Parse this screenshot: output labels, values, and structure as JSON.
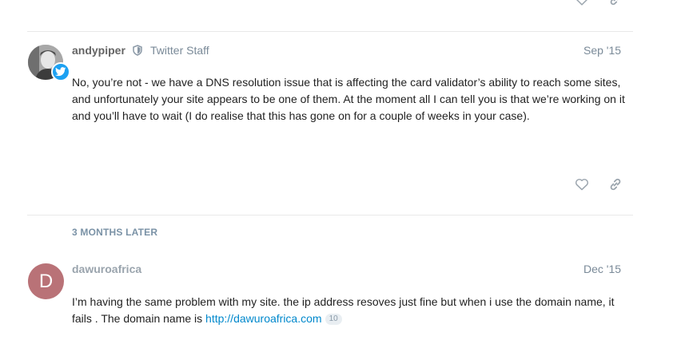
{
  "posts": [
    {
      "username": "andypiper",
      "user_title": "Twitter Staff",
      "date": "Sep '15",
      "text": "No, you’re not - we have a DNS resolution issue that is affecting the card validator’s ability to reach some sites, and unfortunately your site appears to be one of them. At the moment all I can tell you is that we’re working on it and you’ll have to wait (I do realise that this has gone on for a couple of weeks in your case)."
    },
    {
      "username": "dawuroafrica",
      "avatar_letter": "D",
      "date": "Dec '15",
      "text_before_link": "I’m having the same problem with my site. the ip address resoves just fine but when i use the domain name, it fails . The domain name is ",
      "link_text": "http://dawuroafrica.com",
      "link_clicks": "10"
    }
  ],
  "time_gap": "3 MONTHS LATER",
  "icons": {
    "like": "heart-icon",
    "share": "link-icon",
    "moderator": "shield-icon",
    "twitter_badge": "twitter-bird-icon"
  },
  "colors": {
    "twitter_blue": "#1da1f2",
    "link": "#0088cc",
    "letter_avatar": "#b97277",
    "meta_text": "#7a8a98"
  }
}
